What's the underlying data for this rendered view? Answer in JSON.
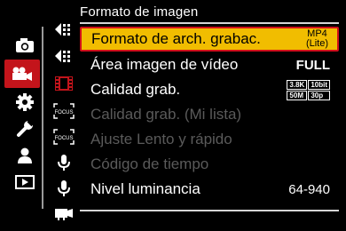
{
  "header": {
    "title": "Formato de imagen"
  },
  "categories": [
    {
      "id": "photo",
      "icon": "camera-icon"
    },
    {
      "id": "video",
      "icon": "video-camera-icon",
      "selected": true
    },
    {
      "id": "custom",
      "icon": "gear-icon"
    },
    {
      "id": "setup",
      "icon": "wrench-icon"
    },
    {
      "id": "mymenu",
      "icon": "person-icon"
    },
    {
      "id": "playback",
      "icon": "playback-icon"
    }
  ],
  "sub_icons": [
    {
      "icon": "arrows-left-icon"
    },
    {
      "icon": "arrows-left-icon-2"
    },
    {
      "icon": "film-strip-icon",
      "active": true
    },
    {
      "icon": "focus-icon",
      "text": "FOCUS"
    },
    {
      "icon": "focus-icon-2",
      "text": "FOCUS"
    },
    {
      "icon": "microphone-icon"
    },
    {
      "icon": "microphone-icon-2"
    },
    {
      "icon": "camera-accessory-icon"
    }
  ],
  "menu": {
    "items": [
      {
        "label": "Formato de arch. grabac.",
        "value_top": "MP4",
        "value_bottom": "(Lite)",
        "selected": true
      },
      {
        "label": "Área imagen de vídeo",
        "value": "FULL"
      },
      {
        "label": "Calidad grab.",
        "badge": [
          "3.8K",
          "10bit",
          "50M",
          "30p"
        ]
      },
      {
        "label": "Calidad grab. (Mi lista)",
        "disabled": true
      },
      {
        "label": "Ajuste Lento y rápido",
        "disabled": true
      },
      {
        "label": "Código de tiempo",
        "disabled": true
      },
      {
        "label": "Nivel luminancia",
        "value": "64-940"
      }
    ]
  },
  "colors": {
    "accent_red": "#c3141b",
    "highlight_yellow": "#f1bd00",
    "disabled_text": "#5a5a5a"
  }
}
